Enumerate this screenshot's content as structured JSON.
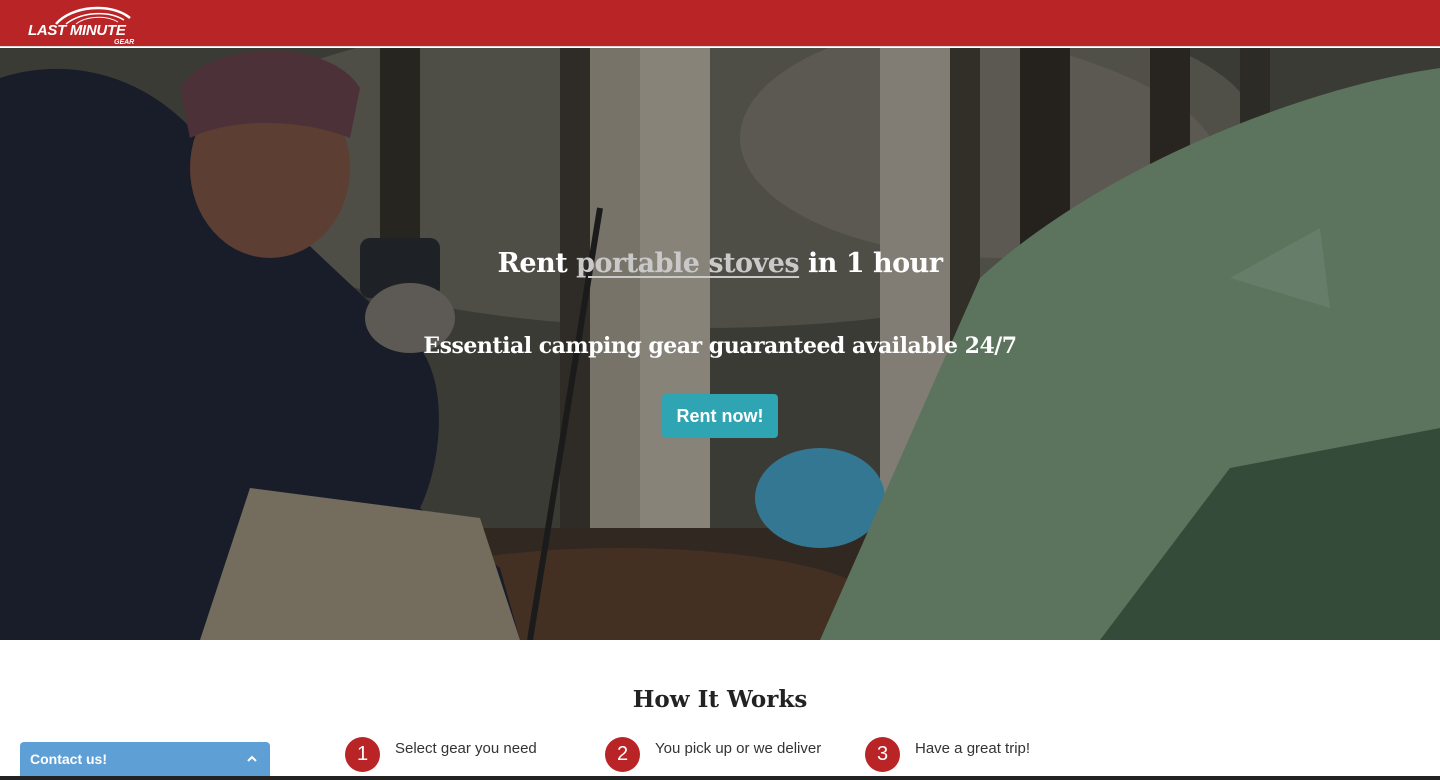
{
  "header": {
    "logo_text": "LAST MINUTE",
    "logo_subtext": "GEAR",
    "background_color": "#b92426"
  },
  "hero": {
    "title_prefix": "Rent ",
    "title_link": "portable stoves",
    "title_suffix": " in 1 hour",
    "subtitle": "Essential camping gear guaranteed available 24/7",
    "cta_label": "Rent now!",
    "cta_color": "#2fa4b3"
  },
  "how_it_works": {
    "title": "How It Works",
    "steps": [
      {
        "number": "1",
        "text": "Select gear you need"
      },
      {
        "number": "2",
        "text": "You pick up or we deliver"
      },
      {
        "number": "3",
        "text": "Have a great trip!"
      }
    ],
    "accent_color": "#b92426"
  },
  "contact_widget": {
    "label": "Contact us!",
    "icon": "chevron-up-icon",
    "color": "#5e9fd6"
  }
}
